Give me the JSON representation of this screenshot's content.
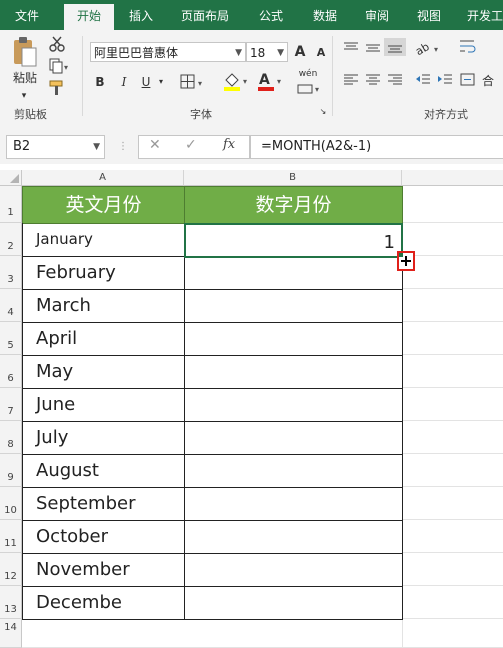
{
  "tabs": [
    "文件",
    "开始",
    "插入",
    "页面布局",
    "公式",
    "数据",
    "审阅",
    "视图",
    "开发工"
  ],
  "active_tab": "开始",
  "clipboard": {
    "paste_label": "粘贴",
    "group_label": "剪贴板"
  },
  "font": {
    "name": "阿里巴巴普惠体",
    "size": "18",
    "group_label": "字体",
    "bold": "B",
    "italic": "I",
    "underline": "U",
    "grow": "A",
    "shrink": "A",
    "pinyin": "wén"
  },
  "alignment": {
    "group_label": "对齐方式",
    "merge_label": "合"
  },
  "formula_bar": {
    "name_box": "B2",
    "formula": "=MONTH(A2&-1)",
    "fx": "fx"
  },
  "sheet": {
    "columns": [
      "A",
      "B"
    ],
    "rows": [
      "1",
      "2",
      "3",
      "4",
      "5",
      "6",
      "7",
      "8",
      "9",
      "10",
      "11",
      "12",
      "13",
      "14"
    ],
    "header": [
      "英文月份",
      "数字月份"
    ],
    "months": [
      "January",
      "February",
      "March",
      "April",
      "May",
      "June",
      "July",
      "August",
      "September",
      "October",
      "November",
      "Decembe"
    ],
    "b2_value": "1"
  },
  "colors": {
    "ribbon_green": "#217346",
    "header_fill": "#70ad47",
    "selection": "#217346",
    "fill_handle_box": "#e0201a"
  }
}
